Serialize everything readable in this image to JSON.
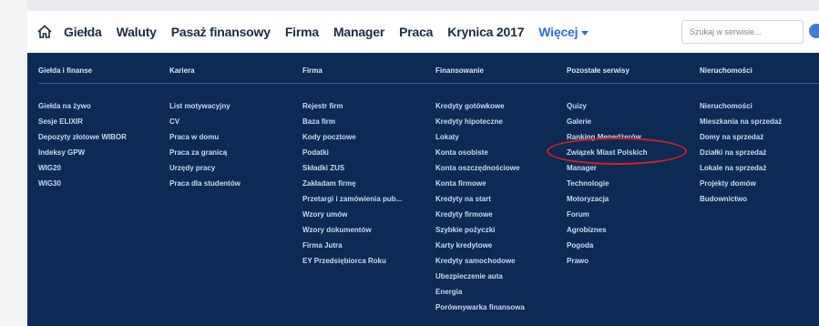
{
  "topnav": {
    "items": [
      "Giełda",
      "Waluty",
      "Pasaż finansowy",
      "Firma",
      "Manager",
      "Praca",
      "Krynica 2017"
    ],
    "more_label": "Więcej"
  },
  "search": {
    "placeholder": "Szukaj w serwisie..."
  },
  "menu": {
    "columns": [
      {
        "title": "Giełda i finanse",
        "items": [
          "Giełda na żywo",
          "Sesje ELIXIR",
          "Depozyty złotowe WIBOR",
          "Indeksy GPW",
          "WIG20",
          "WIG30"
        ]
      },
      {
        "title": "Kariera",
        "items": [
          "List motywacyjny",
          "CV",
          "Praca w domu",
          "Praca za granicą",
          "Urzędy pracy",
          "Praca dla studentów"
        ]
      },
      {
        "title": "Firma",
        "items": [
          "Rejestr firm",
          "Baza firm",
          "Kody pocztowe",
          "Podatki",
          "Składki ZUS",
          "Zakładam firmę",
          "Przetargi i zamówienia pub...",
          "Wzory umów",
          "Wzory dokumentów",
          "Firma Jutra",
          "EY Przedsiębiorca Roku"
        ]
      },
      {
        "title": "Finansowanie",
        "items": [
          "Kredyty gotówkowe",
          "Kredyty hipoteczne",
          "Lokaty",
          "Konta osobiste",
          "Konta oszczędnościowe",
          "Konta firmowe",
          "Kredyty na start",
          "Kredyty firmowe",
          "Szybkie pożyczki",
          "Karty kredytowe",
          "Kredyty samochodowe",
          "Ubezpieczenie auta",
          "Energia",
          "Porównywarka finansowa"
        ]
      },
      {
        "title": "Pozostałe serwisy",
        "items": [
          "Quizy",
          "Galerie",
          "Ranking Menedżerów",
          "Związek Miast Polskich",
          "Manager",
          "Technologie",
          "Motoryzacja",
          "Forum",
          "Agrobiznes",
          "Pogoda",
          "Prawo"
        ]
      },
      {
        "title": "Nieruchomości",
        "items": [
          "Nieruchomości",
          "Mieszkania na sprzedaż",
          "Domy na sprzedaż",
          "Działki na sprzedaż",
          "Lokale na sprzedaż",
          "Projekty domów",
          "Budownictwo"
        ]
      }
    ]
  },
  "colors": {
    "panel": "#0d2a55",
    "accent": "#2a6fd6",
    "highlight": "#d21f25"
  }
}
